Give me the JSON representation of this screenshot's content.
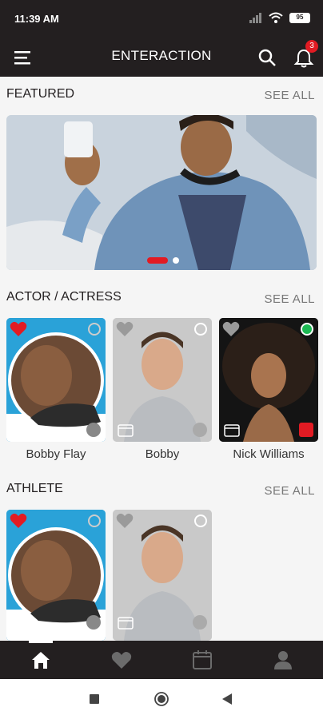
{
  "status": {
    "time": "11:39 AM",
    "battery": "95"
  },
  "header": {
    "title": "ENTERACTION",
    "notification_count": "3"
  },
  "sections": {
    "featured": {
      "title": "FEATURED",
      "see_all": "SEE ALL"
    },
    "actors": {
      "title": "ACTOR / ACTRESS",
      "see_all": "SEE ALL",
      "items": [
        {
          "name": "Bobby Flay",
          "online": false,
          "favorited": true
        },
        {
          "name": "Bobby",
          "online": false,
          "favorited": false
        },
        {
          "name": "Nick Williams",
          "online": true,
          "favorited": false
        }
      ]
    },
    "athletes": {
      "title": "ATHLETE",
      "see_all": "SEE ALL",
      "items": [
        {
          "name": "",
          "online": false,
          "favorited": true
        },
        {
          "name": "",
          "online": false,
          "favorited": false
        }
      ]
    }
  },
  "colors": {
    "brand_dark": "#231f20",
    "accent": "#e21b23",
    "online": "#1db954"
  },
  "icons": {
    "menu": "menu-icon",
    "search": "search-icon",
    "bell": "bell-icon",
    "home": "home-icon",
    "heart": "heart-icon",
    "calendar": "calendar-icon",
    "profile": "profile-icon"
  }
}
